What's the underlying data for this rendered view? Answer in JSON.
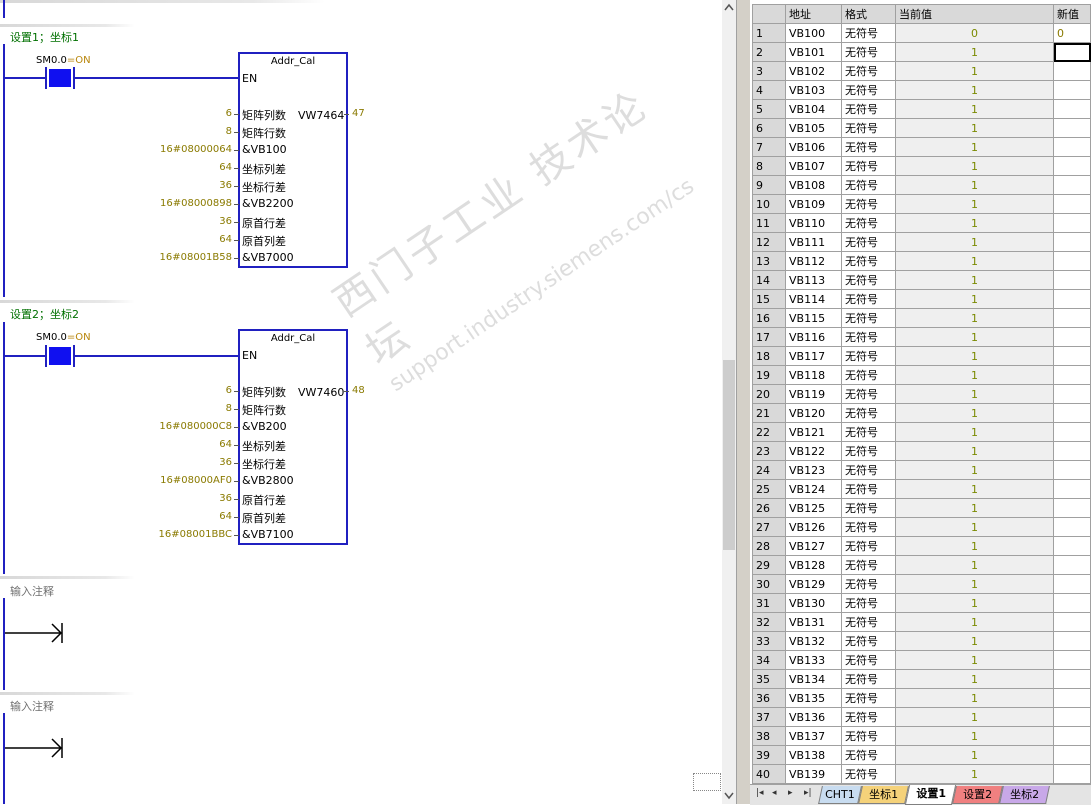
{
  "networks": [
    {
      "title": "设置1；坐标1",
      "contact": {
        "address": "SM0.0",
        "state": "=ON"
      },
      "block": {
        "name": "Addr_Cal",
        "en_label": "EN",
        "pins": [
          {
            "value": "6",
            "label": "矩阵列数"
          },
          {
            "value": "8",
            "label": "矩阵行数"
          },
          {
            "value": "16#08000064",
            "label": "&VB100"
          },
          {
            "value": "64",
            "label": "坐标列差"
          },
          {
            "value": "36",
            "label": "坐标行差"
          },
          {
            "value": "16#08000898",
            "label": "&VB2200"
          },
          {
            "value": "36",
            "label": "原首行差"
          },
          {
            "value": "64",
            "label": "原首列差"
          },
          {
            "value": "16#08001B58",
            "label": "&VB7000"
          }
        ],
        "output": {
          "address": "VW7464",
          "value": "47"
        }
      }
    },
    {
      "title": "设置2；坐标2",
      "contact": {
        "address": "SM0.0",
        "state": "=ON"
      },
      "block": {
        "name": "Addr_Cal",
        "en_label": "EN",
        "pins": [
          {
            "value": "6",
            "label": "矩阵列数"
          },
          {
            "value": "8",
            "label": "矩阵行数"
          },
          {
            "value": "16#080000C8",
            "label": "&VB200"
          },
          {
            "value": "64",
            "label": "坐标列差"
          },
          {
            "value": "36",
            "label": "坐标行差"
          },
          {
            "value": "16#08000AF0",
            "label": "&VB2800"
          },
          {
            "value": "36",
            "label": "原首行差"
          },
          {
            "value": "64",
            "label": "原首列差"
          },
          {
            "value": "16#08001BBC",
            "label": "&VB7100"
          }
        ],
        "output": {
          "address": "VW7460",
          "value": "48"
        }
      }
    }
  ],
  "empty_networks": [
    {
      "comment": "输入注释"
    },
    {
      "comment": "输入注释"
    }
  ],
  "watermark": {
    "line1": "西门子工业 技术论坛",
    "line2": "support.industry.siemens.com/cs"
  },
  "status_chart": {
    "headers": [
      "",
      "地址",
      "格式",
      "当前值",
      "新值"
    ],
    "rows": [
      {
        "n": "1",
        "addr": "VB100",
        "fmt": "无符号",
        "cur": "0",
        "new": "0"
      },
      {
        "n": "2",
        "addr": "VB101",
        "fmt": "无符号",
        "cur": "1",
        "new": ""
      },
      {
        "n": "3",
        "addr": "VB102",
        "fmt": "无符号",
        "cur": "1",
        "new": ""
      },
      {
        "n": "4",
        "addr": "VB103",
        "fmt": "无符号",
        "cur": "1",
        "new": ""
      },
      {
        "n": "5",
        "addr": "VB104",
        "fmt": "无符号",
        "cur": "1",
        "new": ""
      },
      {
        "n": "6",
        "addr": "VB105",
        "fmt": "无符号",
        "cur": "1",
        "new": ""
      },
      {
        "n": "7",
        "addr": "VB106",
        "fmt": "无符号",
        "cur": "1",
        "new": ""
      },
      {
        "n": "8",
        "addr": "VB107",
        "fmt": "无符号",
        "cur": "1",
        "new": ""
      },
      {
        "n": "9",
        "addr": "VB108",
        "fmt": "无符号",
        "cur": "1",
        "new": ""
      },
      {
        "n": "10",
        "addr": "VB109",
        "fmt": "无符号",
        "cur": "1",
        "new": ""
      },
      {
        "n": "11",
        "addr": "VB110",
        "fmt": "无符号",
        "cur": "1",
        "new": ""
      },
      {
        "n": "12",
        "addr": "VB111",
        "fmt": "无符号",
        "cur": "1",
        "new": ""
      },
      {
        "n": "13",
        "addr": "VB112",
        "fmt": "无符号",
        "cur": "1",
        "new": ""
      },
      {
        "n": "14",
        "addr": "VB113",
        "fmt": "无符号",
        "cur": "1",
        "new": ""
      },
      {
        "n": "15",
        "addr": "VB114",
        "fmt": "无符号",
        "cur": "1",
        "new": ""
      },
      {
        "n": "16",
        "addr": "VB115",
        "fmt": "无符号",
        "cur": "1",
        "new": ""
      },
      {
        "n": "17",
        "addr": "VB116",
        "fmt": "无符号",
        "cur": "1",
        "new": ""
      },
      {
        "n": "18",
        "addr": "VB117",
        "fmt": "无符号",
        "cur": "1",
        "new": ""
      },
      {
        "n": "19",
        "addr": "VB118",
        "fmt": "无符号",
        "cur": "1",
        "new": ""
      },
      {
        "n": "20",
        "addr": "VB119",
        "fmt": "无符号",
        "cur": "1",
        "new": ""
      },
      {
        "n": "21",
        "addr": "VB120",
        "fmt": "无符号",
        "cur": "1",
        "new": ""
      },
      {
        "n": "22",
        "addr": "VB121",
        "fmt": "无符号",
        "cur": "1",
        "new": ""
      },
      {
        "n": "23",
        "addr": "VB122",
        "fmt": "无符号",
        "cur": "1",
        "new": ""
      },
      {
        "n": "24",
        "addr": "VB123",
        "fmt": "无符号",
        "cur": "1",
        "new": ""
      },
      {
        "n": "25",
        "addr": "VB124",
        "fmt": "无符号",
        "cur": "1",
        "new": ""
      },
      {
        "n": "26",
        "addr": "VB125",
        "fmt": "无符号",
        "cur": "1",
        "new": ""
      },
      {
        "n": "27",
        "addr": "VB126",
        "fmt": "无符号",
        "cur": "1",
        "new": ""
      },
      {
        "n": "28",
        "addr": "VB127",
        "fmt": "无符号",
        "cur": "1",
        "new": ""
      },
      {
        "n": "29",
        "addr": "VB128",
        "fmt": "无符号",
        "cur": "1",
        "new": ""
      },
      {
        "n": "30",
        "addr": "VB129",
        "fmt": "无符号",
        "cur": "1",
        "new": ""
      },
      {
        "n": "31",
        "addr": "VB130",
        "fmt": "无符号",
        "cur": "1",
        "new": ""
      },
      {
        "n": "32",
        "addr": "VB131",
        "fmt": "无符号",
        "cur": "1",
        "new": ""
      },
      {
        "n": "33",
        "addr": "VB132",
        "fmt": "无符号",
        "cur": "1",
        "new": ""
      },
      {
        "n": "34",
        "addr": "VB133",
        "fmt": "无符号",
        "cur": "1",
        "new": ""
      },
      {
        "n": "35",
        "addr": "VB134",
        "fmt": "无符号",
        "cur": "1",
        "new": ""
      },
      {
        "n": "36",
        "addr": "VB135",
        "fmt": "无符号",
        "cur": "1",
        "new": ""
      },
      {
        "n": "37",
        "addr": "VB136",
        "fmt": "无符号",
        "cur": "1",
        "new": ""
      },
      {
        "n": "38",
        "addr": "VB137",
        "fmt": "无符号",
        "cur": "1",
        "new": ""
      },
      {
        "n": "39",
        "addr": "VB138",
        "fmt": "无符号",
        "cur": "1",
        "new": ""
      },
      {
        "n": "40",
        "addr": "VB139",
        "fmt": "无符号",
        "cur": "1",
        "new": ""
      }
    ]
  },
  "tabs": [
    {
      "label": "CHT1",
      "color": "#c8dcf0",
      "active": false
    },
    {
      "label": "坐标1",
      "color": "#f5d27a",
      "active": false
    },
    {
      "label": "设置1",
      "color": "#ffffff",
      "active": true
    },
    {
      "label": "设置2",
      "color": "#f08080",
      "active": false
    },
    {
      "label": "坐标2",
      "color": "#c8a8e8",
      "active": false
    }
  ],
  "tab_nav": [
    "|◂",
    "◂",
    "▸",
    "▸|"
  ],
  "colors": {
    "rail": "#2020c0",
    "contact_on": "#1010f0",
    "value": "#8a7a00",
    "title": "#007000"
  }
}
